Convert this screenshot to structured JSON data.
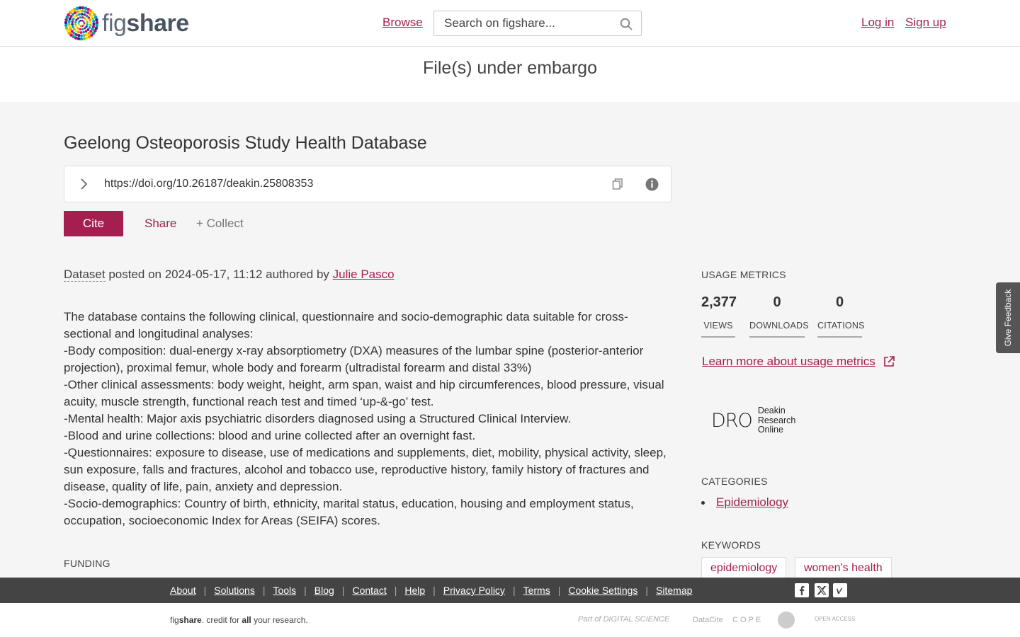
{
  "header": {
    "logo_text_light": "fig",
    "logo_text_bold": "share",
    "browse_label": "Browse",
    "search_placeholder": "Search on figshare...",
    "login_label": "Log in",
    "signup_label": "Sign up"
  },
  "embargo": {
    "text": "File(s) under embargo"
  },
  "item": {
    "title": "Geelong Osteoporosis Study Health Database",
    "doi": "https://doi.org/10.26187/deakin.25808353",
    "cite_label": "Cite",
    "share_label": "Share",
    "collect_label": "+ Collect",
    "type_label": "Dataset",
    "posted_text": " posted on 2024-05-17, 11:12 authored by ",
    "author": "Julie Pasco",
    "description": [
      "The database contains the following clinical, questionnaire and socio-demographic data suitable for cross-sectional and longitudinal analyses:",
      "-Body composition: dual-energy x-ray absorptiometry (DXA) measures of the lumbar spine (posterior-anterior projection), proximal femur, whole body and forearm (ultradistal forearm and distal 33%)",
      "-Other clinical assessments: body weight, height, arm span, waist and hip circumferences, blood pressure, visual acuity, muscle strength, functional reach test and timed ‘up-&-go’ test.",
      "-Mental health: Major axis psychiatric disorders diagnosed using a Structured Clinical Interview.",
      "-Blood and urine collections: blood and urine collected after an overnight fast.",
      "-Questionnaires: exposure to disease, use of medications and supplements, diet, mobility, physical activity, sleep, sun exposure, falls and fractures, alcohol and tobacco use, reproductive history, family history of fractures and disease, quality of life, pain, anxiety and depression.",
      "-Socio-demographics: Country of birth, ethnicity, marital status, education, housing and employment status, occupation, socioeconomic Index for Areas (SEIFA) scores."
    ],
    "funding_heading": "FUNDING"
  },
  "sidebar": {
    "usage_heading": "USAGE METRICS",
    "metrics": [
      {
        "value": "2,377",
        "label": "VIEWS"
      },
      {
        "value": "0",
        "label": "DOWNLOADS"
      },
      {
        "value": "0",
        "label": "CITATIONS"
      }
    ],
    "learn_more": "Learn more about usage metrics",
    "dro_big": "DRO",
    "dro_line1": "Deakin",
    "dro_line2": "Research",
    "dro_line3": "Online",
    "categories_heading": "CATEGORIES",
    "categories": [
      "Epidemiology"
    ],
    "keywords_heading": "KEYWORDS",
    "keywords": [
      "epidemiology",
      "women's health"
    ]
  },
  "feedback_label": "Give Feedback",
  "footer": {
    "links": [
      "About",
      "Solutions",
      "Tools",
      "Blog",
      "Contact",
      "Help",
      "Privacy Policy",
      "Terms",
      "Cookie Settings",
      "Sitemap"
    ],
    "tagline_fig": "fig",
    "tagline_share": "share",
    "tagline_mid": ". credit for ",
    "tagline_all": "all",
    "tagline_end": " your research.",
    "partners": [
      "Part of DIGITAL SCIENCE",
      "DataCite",
      "COPE",
      "OPEN ACCESS"
    ],
    "social_icons": [
      "facebook-icon",
      "x-icon",
      "vimeo-icon"
    ]
  },
  "colors": {
    "accent": "#a41f4f",
    "footer_bg": "#444444",
    "page_bg": "#f5f5f5"
  }
}
